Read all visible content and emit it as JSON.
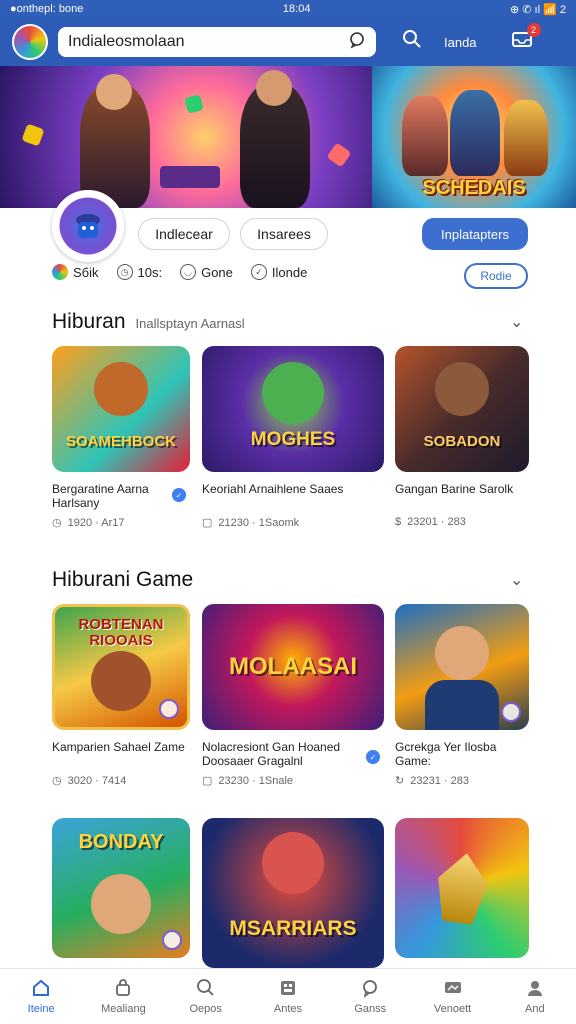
{
  "status_bar": {
    "left": "●onthepl: bone",
    "time": "18:04",
    "icons": "⊕ ✆ ıl 📶 2"
  },
  "header": {
    "search_value": "Indialeosmolaan",
    "right_label": "Ianda",
    "notification_count": "2"
  },
  "banner": {
    "right_title": "SCHEDAIS"
  },
  "profile": {
    "pill1": "Indlecear",
    "pill2": "Insarees",
    "primary_button": "Inplatapters"
  },
  "stats": [
    {
      "label": "Sбik",
      "icon": "color-logo-icon"
    },
    {
      "label": "10s:",
      "icon": "clock-icon"
    },
    {
      "label": "Gone",
      "icon": "chat-icon"
    },
    {
      "label": "Ilonde",
      "icon": "check-icon"
    }
  ],
  "stats_button": "Rodie",
  "section1": {
    "title": "Hiburan",
    "subtitle": "Inallsptayn Aarnasl",
    "cards": [
      {
        "thumb_title": "SOAMEHBOCK",
        "name": "Bergaratine Aarna Harlsany",
        "meta": "1920 · Ar17",
        "verified": true,
        "colors": [
          "#ff9f1c",
          "#2ec4b6",
          "#e71d36"
        ]
      },
      {
        "thumb_title": "MOGHES",
        "name": "Keoriahl Arnaihlene Saaes",
        "meta": "21230 · 1Saomk",
        "verified": false,
        "colors": [
          "#5a2ea6",
          "#2b1a66",
          "#8fd14f"
        ]
      },
      {
        "thumb_title": "SOBADON",
        "name": "Gangan Barine Sarolk",
        "meta": "23201 · 283",
        "verified": false,
        "colors": [
          "#4a2c2a",
          "#b5532d",
          "#1f1a2e"
        ]
      }
    ]
  },
  "section2": {
    "title": "Hiburani Game",
    "cards": [
      {
        "thumb_title": "ROBTENAN RIOOAIS",
        "name": "Kamparien Sahael Zame",
        "meta": "3020 · 7414",
        "verified": false,
        "colors": [
          "#f6c945",
          "#3fa34d",
          "#d35400"
        ]
      },
      {
        "thumb_title": "MOLAASAI",
        "name": "Nolacresiont Gan Hoaned Doosaaer Gragalnl",
        "meta": "23230 · 1Snale",
        "verified": true,
        "colors": [
          "#3b1f7a",
          "#c2185b",
          "#ffb300"
        ]
      },
      {
        "thumb_title": "",
        "name": "Gcrekga Yer Ilosba Game:",
        "meta": "23231 · 283",
        "verified": false,
        "colors": [
          "#1e6fc2",
          "#f39c12",
          "#2c3e50"
        ]
      }
    ]
  },
  "section3": {
    "cards": [
      {
        "thumb_title": "BONDAY",
        "colors": [
          "#3ba3d9",
          "#e67e22",
          "#27ae60"
        ]
      },
      {
        "thumb_title": "MSARRIARS",
        "colors": [
          "#1c2a6b",
          "#e74c3c",
          "#f1c40f"
        ]
      },
      {
        "thumb_title": "",
        "colors": [
          "#e74c3c",
          "#f1c40f",
          "#2ecc71"
        ]
      }
    ]
  },
  "bottom_nav": [
    {
      "label": "Iteine",
      "icon": "home-icon",
      "active": true
    },
    {
      "label": "Mealiang",
      "icon": "bag-icon",
      "active": false
    },
    {
      "label": "Oepos",
      "icon": "search-icon",
      "active": false
    },
    {
      "label": "Antes",
      "icon": "grid-icon",
      "active": false
    },
    {
      "label": "Ganss",
      "icon": "chat-icon",
      "active": false
    },
    {
      "label": "Venoett",
      "icon": "tv-icon",
      "active": false
    },
    {
      "label": "And",
      "icon": "profile-icon",
      "active": false
    }
  ],
  "accent_color": "#2d5cb6"
}
